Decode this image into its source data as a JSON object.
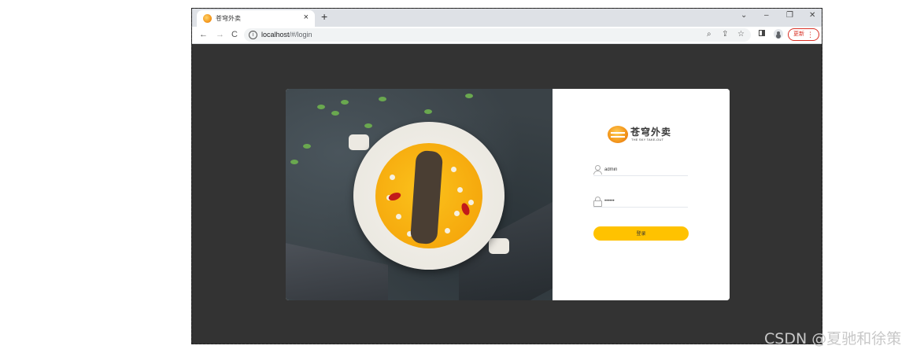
{
  "browser": {
    "tab": {
      "title": "苍穹外卖",
      "close": "×"
    },
    "new_tab": "+",
    "window_controls": {
      "tab_search": "⌄",
      "minimize": "–",
      "restore": "❐",
      "close": "✕"
    },
    "nav": {
      "back": "←",
      "forward": "→",
      "reload": "C"
    },
    "address_bar": {
      "host": "localhost",
      "path": "/#/login"
    },
    "update_button": {
      "label": "更新",
      "menu": "⋮"
    },
    "icons": [
      "zoom-icon",
      "share-icon",
      "bookmark-star-icon",
      "side-panel-icon",
      "profile-icon"
    ]
  },
  "login": {
    "logo": {
      "title": "苍穹外卖",
      "subtitle": "THE SKY TAKE-OUT"
    },
    "username": {
      "value": "admin"
    },
    "password": {
      "value": "••••••"
    },
    "submit_label": "登录"
  },
  "watermark": "CSDN @夏驰和徐策",
  "colors": {
    "page_bg": "#333333",
    "accent": "#ffc200",
    "update_red": "#d93025"
  }
}
